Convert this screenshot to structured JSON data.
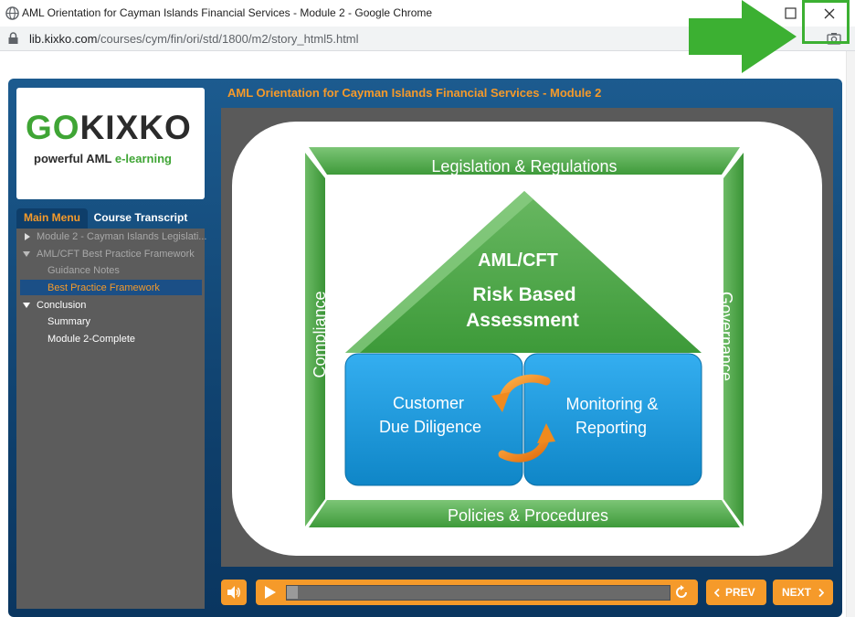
{
  "window": {
    "title": "AML Orientation for Cayman Islands Financial Services - Module 2 - Google Chrome",
    "url_host": "lib.kixko.com",
    "url_path": "/courses/cym/fin/ori/std/1800/m2/story_html5.html"
  },
  "course": {
    "title": "AML Orientation for Cayman Islands Financial Services - Module 2"
  },
  "logo": {
    "word_go": "GO",
    "word_kixko": "KIXKO",
    "tagline_a": "powerful AML ",
    "tagline_b": "e-learning"
  },
  "tabs": {
    "main_menu": "Main Menu",
    "transcript": "Course Transcript"
  },
  "menu": {
    "items": [
      {
        "label": "Module 2 - Cayman Islands Legislati..."
      },
      {
        "label": "AML/CFT Best Practice Framework"
      },
      {
        "label": "Guidance Notes"
      },
      {
        "label": "Best Practice Framework"
      },
      {
        "label": "Conclusion"
      },
      {
        "label": "Summary"
      },
      {
        "label": "Module 2-Complete"
      }
    ]
  },
  "diagram": {
    "top": "Legislation & Regulations",
    "bottom": "Policies & Procedures",
    "left": "Compliance",
    "right": "Governance",
    "roof_line1": "AML/CFT",
    "roof_line2": "Risk Based",
    "roof_line3": "Assessment",
    "box_left_1": "Customer",
    "box_left_2": "Due Diligence",
    "box_right_1": "Monitoring &",
    "box_right_2": "Reporting"
  },
  "controls": {
    "prev": "PREV",
    "next": "NEXT"
  },
  "colors": {
    "accent_orange": "#f59a2a",
    "player_blue": "#0e3e6a",
    "frame_green": "#4caf50",
    "box_blue": "#1e9ad6",
    "highlight_green": "#3cb032"
  },
  "icons": {
    "globe": "globe-icon",
    "lock": "lock-icon",
    "maximize": "maximize-icon",
    "close": "close-icon",
    "camera": "camera-icon",
    "volume": "volume-icon",
    "play": "play-icon",
    "replay": "replay-icon"
  }
}
